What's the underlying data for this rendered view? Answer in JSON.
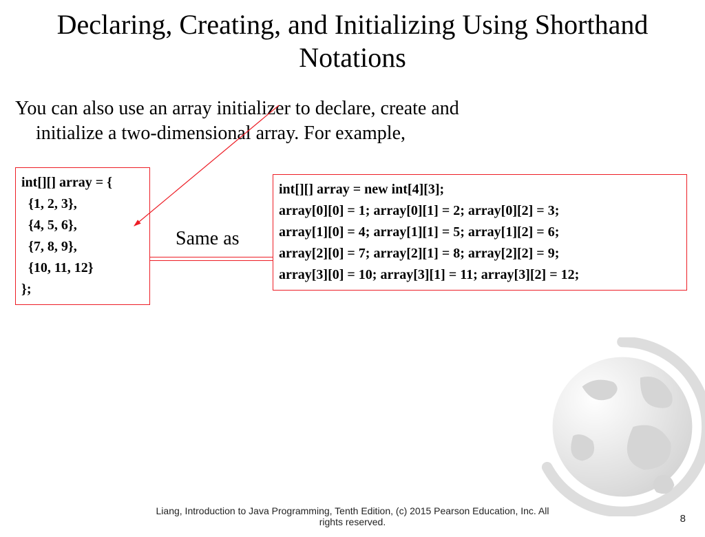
{
  "title": "Declaring, Creating, and Initializing Using Shorthand Notations",
  "body_text_line1": "You can also use an array initializer to declare, create and",
  "body_text_line2": "initialize a two-dimensional array. For example,",
  "same_as": "Same as",
  "code_left": [
    "int[][] array = {",
    "  {1, 2, 3},",
    "  {4, 5, 6},",
    "  {7, 8, 9},",
    "  {10, 11, 12}",
    "};"
  ],
  "code_right": [
    "int[][] array = new int[4][3];",
    "array[0][0] = 1; array[0][1] = 2; array[0][2] = 3;",
    "array[1][0] = 4; array[1][1] = 5; array[1][2] = 6;",
    "array[2][0] = 7; array[2][1] = 8; array[2][2] = 9;",
    "array[3][0] = 10; array[3][1] = 11; array[3][2] = 12;"
  ],
  "footer_line1": "Liang, Introduction to Java Programming, Tenth Edition, (c) 2015 Pearson Education, Inc. All",
  "footer_line2": "rights reserved.",
  "page_number": "8"
}
